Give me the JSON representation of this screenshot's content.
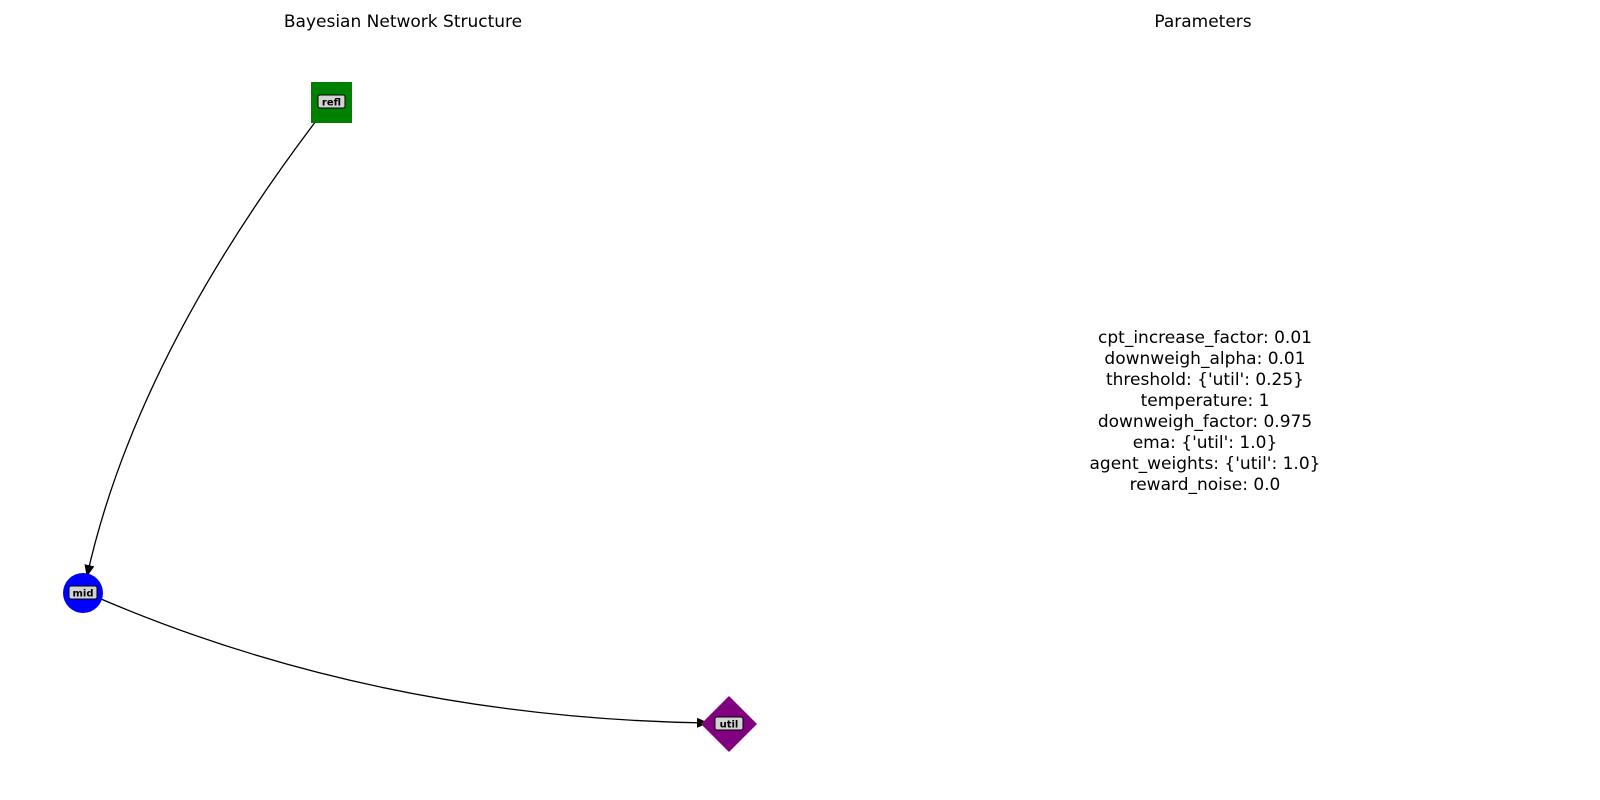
{
  "left_panel": {
    "title": "Bayesian Network Structure"
  },
  "right_panel": {
    "title": "Parameters"
  },
  "nodes": [
    {
      "id": "refl",
      "label": "refl",
      "shape": "square",
      "color": "#008000"
    },
    {
      "id": "mid",
      "label": "mid",
      "shape": "circle",
      "color": "#0000ff"
    },
    {
      "id": "util",
      "label": "util",
      "shape": "diamond",
      "color": "#800080"
    }
  ],
  "edges": [
    {
      "from": "refl",
      "to": "mid"
    },
    {
      "from": "mid",
      "to": "util"
    }
  ],
  "parameters": [
    "cpt_increase_factor: 0.01",
    "downweigh_alpha: 0.01",
    "threshold: {'util': 0.25}",
    "temperature: 1",
    "downweigh_factor: 0.975",
    "ema: {'util': 1.0}",
    "agent_weights: {'util': 1.0}",
    "reward_noise: 0.0"
  ]
}
